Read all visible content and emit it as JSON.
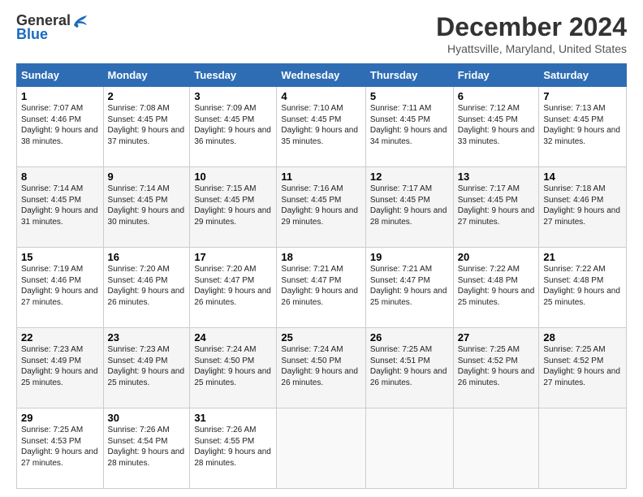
{
  "logo": {
    "general": "General",
    "blue": "Blue"
  },
  "header": {
    "title": "December 2024",
    "subtitle": "Hyattsville, Maryland, United States"
  },
  "weekdays": [
    "Sunday",
    "Monday",
    "Tuesday",
    "Wednesday",
    "Thursday",
    "Friday",
    "Saturday"
  ],
  "weeks": [
    [
      {
        "day": "1",
        "sunrise": "7:07 AM",
        "sunset": "4:46 PM",
        "daylight": "9 hours and 38 minutes."
      },
      {
        "day": "2",
        "sunrise": "7:08 AM",
        "sunset": "4:45 PM",
        "daylight": "9 hours and 37 minutes."
      },
      {
        "day": "3",
        "sunrise": "7:09 AM",
        "sunset": "4:45 PM",
        "daylight": "9 hours and 36 minutes."
      },
      {
        "day": "4",
        "sunrise": "7:10 AM",
        "sunset": "4:45 PM",
        "daylight": "9 hours and 35 minutes."
      },
      {
        "day": "5",
        "sunrise": "7:11 AM",
        "sunset": "4:45 PM",
        "daylight": "9 hours and 34 minutes."
      },
      {
        "day": "6",
        "sunrise": "7:12 AM",
        "sunset": "4:45 PM",
        "daylight": "9 hours and 33 minutes."
      },
      {
        "day": "7",
        "sunrise": "7:13 AM",
        "sunset": "4:45 PM",
        "daylight": "9 hours and 32 minutes."
      }
    ],
    [
      {
        "day": "8",
        "sunrise": "7:14 AM",
        "sunset": "4:45 PM",
        "daylight": "9 hours and 31 minutes."
      },
      {
        "day": "9",
        "sunrise": "7:14 AM",
        "sunset": "4:45 PM",
        "daylight": "9 hours and 30 minutes."
      },
      {
        "day": "10",
        "sunrise": "7:15 AM",
        "sunset": "4:45 PM",
        "daylight": "9 hours and 29 minutes."
      },
      {
        "day": "11",
        "sunrise": "7:16 AM",
        "sunset": "4:45 PM",
        "daylight": "9 hours and 29 minutes."
      },
      {
        "day": "12",
        "sunrise": "7:17 AM",
        "sunset": "4:45 PM",
        "daylight": "9 hours and 28 minutes."
      },
      {
        "day": "13",
        "sunrise": "7:17 AM",
        "sunset": "4:45 PM",
        "daylight": "9 hours and 27 minutes."
      },
      {
        "day": "14",
        "sunrise": "7:18 AM",
        "sunset": "4:46 PM",
        "daylight": "9 hours and 27 minutes."
      }
    ],
    [
      {
        "day": "15",
        "sunrise": "7:19 AM",
        "sunset": "4:46 PM",
        "daylight": "9 hours and 27 minutes."
      },
      {
        "day": "16",
        "sunrise": "7:20 AM",
        "sunset": "4:46 PM",
        "daylight": "9 hours and 26 minutes."
      },
      {
        "day": "17",
        "sunrise": "7:20 AM",
        "sunset": "4:47 PM",
        "daylight": "9 hours and 26 minutes."
      },
      {
        "day": "18",
        "sunrise": "7:21 AM",
        "sunset": "4:47 PM",
        "daylight": "9 hours and 26 minutes."
      },
      {
        "day": "19",
        "sunrise": "7:21 AM",
        "sunset": "4:47 PM",
        "daylight": "9 hours and 25 minutes."
      },
      {
        "day": "20",
        "sunrise": "7:22 AM",
        "sunset": "4:48 PM",
        "daylight": "9 hours and 25 minutes."
      },
      {
        "day": "21",
        "sunrise": "7:22 AM",
        "sunset": "4:48 PM",
        "daylight": "9 hours and 25 minutes."
      }
    ],
    [
      {
        "day": "22",
        "sunrise": "7:23 AM",
        "sunset": "4:49 PM",
        "daylight": "9 hours and 25 minutes."
      },
      {
        "day": "23",
        "sunrise": "7:23 AM",
        "sunset": "4:49 PM",
        "daylight": "9 hours and 25 minutes."
      },
      {
        "day": "24",
        "sunrise": "7:24 AM",
        "sunset": "4:50 PM",
        "daylight": "9 hours and 25 minutes."
      },
      {
        "day": "25",
        "sunrise": "7:24 AM",
        "sunset": "4:50 PM",
        "daylight": "9 hours and 26 minutes."
      },
      {
        "day": "26",
        "sunrise": "7:25 AM",
        "sunset": "4:51 PM",
        "daylight": "9 hours and 26 minutes."
      },
      {
        "day": "27",
        "sunrise": "7:25 AM",
        "sunset": "4:52 PM",
        "daylight": "9 hours and 26 minutes."
      },
      {
        "day": "28",
        "sunrise": "7:25 AM",
        "sunset": "4:52 PM",
        "daylight": "9 hours and 27 minutes."
      }
    ],
    [
      {
        "day": "29",
        "sunrise": "7:25 AM",
        "sunset": "4:53 PM",
        "daylight": "9 hours and 27 minutes."
      },
      {
        "day": "30",
        "sunrise": "7:26 AM",
        "sunset": "4:54 PM",
        "daylight": "9 hours and 28 minutes."
      },
      {
        "day": "31",
        "sunrise": "7:26 AM",
        "sunset": "4:55 PM",
        "daylight": "9 hours and 28 minutes."
      },
      null,
      null,
      null,
      null
    ]
  ]
}
